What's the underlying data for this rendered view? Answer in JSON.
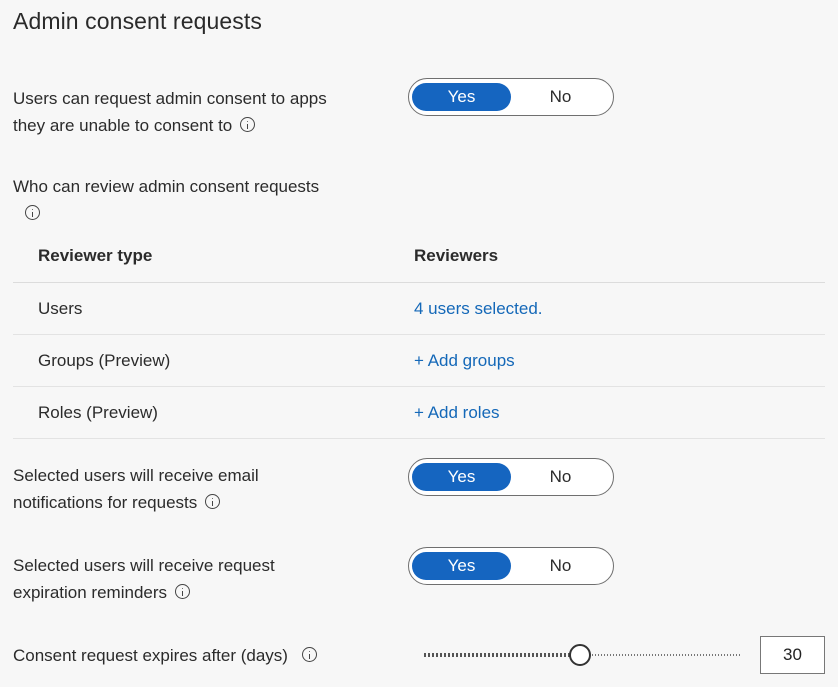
{
  "title": "Admin consent requests",
  "request_setting": {
    "label_line1": "Users can request admin consent to apps",
    "label_line2": "they are unable to consent to",
    "toggle": {
      "yes": "Yes",
      "no": "No",
      "selected": "Yes"
    }
  },
  "reviewers_section": {
    "label": "Who can review admin consent requests",
    "table": {
      "headers": [
        "Reviewer type",
        "Reviewers"
      ],
      "rows": [
        {
          "type": "Users",
          "value": "4 users selected."
        },
        {
          "type": "Groups (Preview)",
          "value": "+ Add groups"
        },
        {
          "type": "Roles (Preview)",
          "value": "+ Add roles"
        }
      ]
    }
  },
  "email_setting": {
    "label_line1": "Selected users will receive email",
    "label_line2": "notifications for requests",
    "toggle": {
      "yes": "Yes",
      "no": "No",
      "selected": "Yes"
    }
  },
  "reminder_setting": {
    "label_line1": "Selected users will receive request",
    "label_line2": "expiration reminders",
    "toggle": {
      "yes": "Yes",
      "no": "No",
      "selected": "Yes"
    }
  },
  "expiry_setting": {
    "label": "Consent request expires after (days)",
    "value": "30",
    "slider_fraction": 0.49
  },
  "colors": {
    "accent": "#1565c0",
    "link": "#1468b8",
    "background": "#f7f7f7"
  }
}
